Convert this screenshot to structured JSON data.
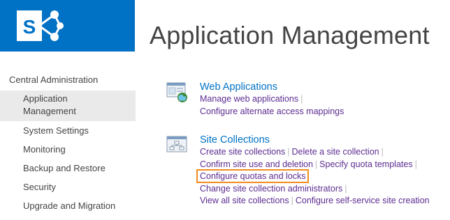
{
  "logo": {
    "letter": "S"
  },
  "page_title": "Application Management",
  "leftnav": {
    "header": "Central Administration",
    "items": [
      {
        "label_line1": "Application",
        "label_line2": "Management",
        "selected": true
      },
      {
        "label": "System Settings"
      },
      {
        "label": "Monitoring"
      },
      {
        "label": "Backup and Restore"
      },
      {
        "label": "Security"
      },
      {
        "label": "Upgrade and Migration"
      }
    ]
  },
  "sections": {
    "web_apps": {
      "icon": "web-applications-icon",
      "title": "Web Applications",
      "links": [
        [
          "Manage web applications"
        ],
        [
          "Configure alternate access mappings"
        ]
      ]
    },
    "site_collections": {
      "icon": "site-collections-icon",
      "title": "Site Collections",
      "links": [
        [
          "Create site collections",
          "Delete a site collection"
        ],
        [
          "Confirm site use and deletion",
          "Specify quota templates"
        ],
        [
          "Configure quotas and locks"
        ],
        [
          "Change site collection administrators"
        ],
        [
          "View all site collections",
          "Configure self-service site creation"
        ]
      ]
    }
  },
  "colors": {
    "brand": "#0072c6",
    "link": "#5c2d91",
    "highlight": "#f08c1e"
  }
}
